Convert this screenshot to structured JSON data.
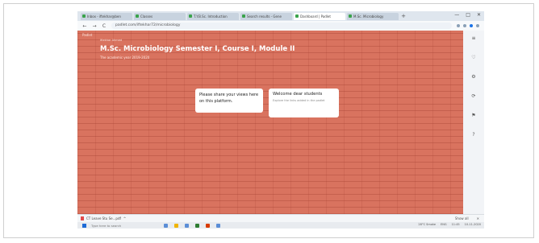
{
  "browser": {
    "tabs": [
      {
        "label": "Inbox - iftekhar@ben",
        "active": false
      },
      {
        "label": "Classes",
        "active": false
      },
      {
        "label": "T.Y.B.Sc. Introduction",
        "active": false
      },
      {
        "label": "Search results - Gene",
        "active": false
      },
      {
        "label": "Dashboard | Padlet",
        "active": true
      },
      {
        "label": "M.Sc. Microbiology",
        "active": false
      }
    ],
    "new_tab": "+",
    "window_controls": [
      "—",
      "□",
      "✕"
    ],
    "url": "padlet.com/iftekhar72/microbiology",
    "back": "←",
    "forward": "→",
    "reload": "C"
  },
  "padlet": {
    "brand": "Padlet",
    "author": "Iftekhar Ahmed",
    "title": "M.Sc. Microbiology Semester I, Course I, Module II",
    "subtitle": "The academic year 2019-2020",
    "cards": [
      {
        "text": "Please share your views here on this platform."
      },
      {
        "title": "Welcome dear students",
        "body": "Explore the links added in the padlet"
      }
    ],
    "fab": "+"
  },
  "side_panel": {
    "icons": [
      "≡",
      "♡",
      "⚙",
      "⟳",
      "⚑",
      "?"
    ]
  },
  "downloads": {
    "file": "CT Leave Stu Se...pdf",
    "chevron": "^",
    "show_all": "Show all",
    "close": "✕"
  },
  "taskbar": {
    "search_placeholder": "Type here to search",
    "tray_weather": "28°C Smoke",
    "tray_lang": "ENG",
    "time": "11:45",
    "date": "10-11-2020"
  },
  "colors": {
    "padlet_bg": "#d9735f",
    "fab": "#e84f6a"
  }
}
